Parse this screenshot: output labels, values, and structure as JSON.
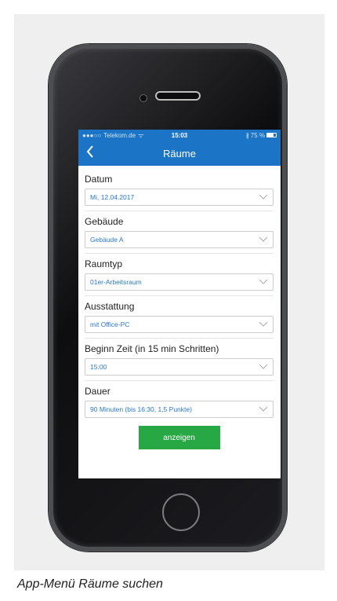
{
  "caption": "App-Menü Räume suchen",
  "statusbar": {
    "carrier": "Telekom.de",
    "time": "15:03",
    "battery": "75 %"
  },
  "navbar": {
    "back_icon": "chevron-left-icon",
    "title": "Räume"
  },
  "form": {
    "fields": [
      {
        "label": "Datum",
        "value": "Mi, 12.04.2017"
      },
      {
        "label": "Gebäude",
        "value": "Gebäude A"
      },
      {
        "label": "Raumtyp",
        "value": "01er-Arbeitsraum"
      },
      {
        "label": "Ausstattung",
        "value": "mit Office-PC"
      },
      {
        "label": "Beginn Zeit (in 15 min Schritten)",
        "value": "15:00"
      },
      {
        "label": "Dauer",
        "value": "90 Minuten (bis 16:30, 1,5 Punkte)"
      }
    ],
    "submit_label": "anzeigen"
  },
  "colors": {
    "brand_blue": "#1b74c5",
    "button_green": "#27a844",
    "select_text": "#2b78c7"
  }
}
